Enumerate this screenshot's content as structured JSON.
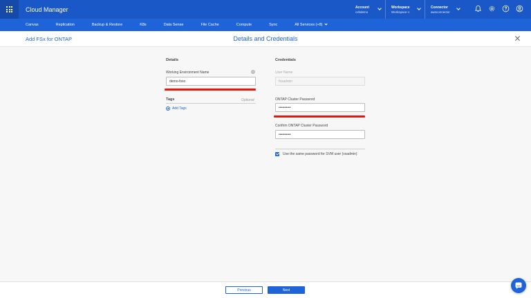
{
  "header": {
    "app_title": "Cloud Manager",
    "account": {
      "label": "Account",
      "value": "cvbdemo"
    },
    "workspace": {
      "label": "Workspace",
      "value": "Workspace-1"
    },
    "connector": {
      "label": "Connector",
      "value": "awsconnector"
    },
    "icons": [
      "bell-icon",
      "gear-icon",
      "help-icon",
      "user-icon"
    ],
    "accent_color": "#1a57c7"
  },
  "nav": {
    "tabs": [
      "Canvas",
      "Replication",
      "Backup & Restore",
      "K8s",
      "Data Sense",
      "File Cache",
      "Compute",
      "Sync",
      "All Services (+8)"
    ]
  },
  "subheader": {
    "wizard_title": "Add FSx for ONTAP",
    "step_title": "Details and Credentials"
  },
  "details": {
    "title": "Details",
    "working_env_label": "Working Environment Name",
    "working_env_value": "demo-fsxo",
    "tags_label": "Tags",
    "tags_optional": "Optional",
    "add_tags": "Add Tags"
  },
  "credentials": {
    "title": "Credentials",
    "username_label": "User Name",
    "username_value": "fsxadmin",
    "password_label": "ONTAP Cluster Password",
    "password_value": "••••••••••",
    "confirm_label": "Confirm ONTAP Cluster Password",
    "confirm_value": "••••••••••",
    "svm_checkbox_label": "Use the same password for SVM user (vsadmin)",
    "svm_checked": true
  },
  "footer": {
    "previous": "Previous",
    "next": "Next"
  },
  "annotation_color": "#e8150c"
}
